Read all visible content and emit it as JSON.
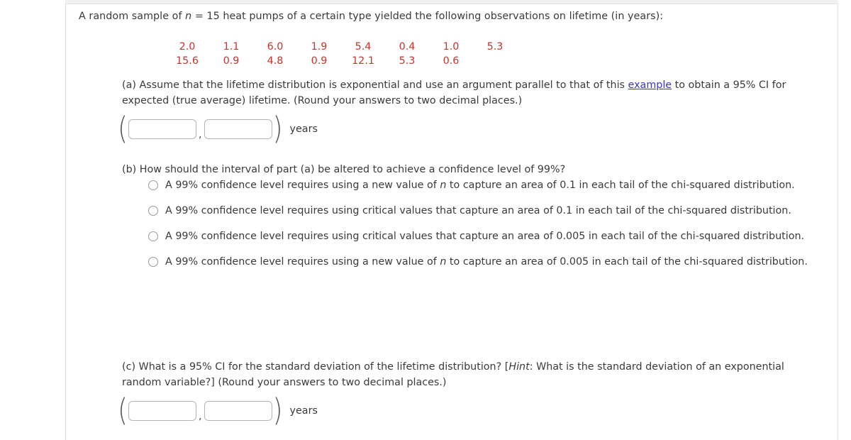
{
  "question": {
    "intro_pre": "A random sample of ",
    "intro_var": "n",
    "intro_post": " = 15 heat pumps of a certain type yielded the following observations on lifetime (in years):",
    "observations_row1": [
      "2.0",
      "1.1",
      "6.0",
      "1.9",
      "5.4",
      "0.4",
      "1.0",
      "5.3"
    ],
    "observations_row2": [
      "15.6",
      "0.9",
      "4.8",
      "0.9",
      "12.1",
      "5.3",
      "0.6"
    ]
  },
  "part_a": {
    "text_1": "(a) Assume that the lifetime distribution is exponential and use an argument parallel to that of this ",
    "link_text": "example",
    "text_2": " to obtain a 95% CI for expected (true average) lifetime. (Round your answers to two decimal places.)",
    "open_paren": "(",
    "close_paren": ")",
    "comma": ",",
    "lower_value": "",
    "upper_value": "",
    "units": "years"
  },
  "part_b": {
    "prompt": "(b) How should the interval of part (a) be altered to achieve a confidence level of 99%?",
    "options": [
      {
        "pre": "A 99% confidence level requires using a new value of ",
        "var": "n",
        "post": " to capture an area of 0.1 in each tail of the chi-squared distribution."
      },
      {
        "pre": "A 99% confidence level requires using critical values that capture an area of 0.1 in each tail of the chi-squared distribution.",
        "var": "",
        "post": ""
      },
      {
        "pre": "A 99% confidence level requires using critical values that capture an area of 0.005 in each tail of the chi-squared distribution.",
        "var": "",
        "post": ""
      },
      {
        "pre": "A 99% confidence level requires using a new value of ",
        "var": "n",
        "post": " to capture an area of 0.005 in each tail of the chi-squared distribution."
      }
    ]
  },
  "part_c": {
    "text_1": "(c) What is a 95% CI for the standard deviation of the lifetime distribution? [",
    "hint_word": "Hint",
    "text_2": ": What is the standard deviation of an exponential random variable?] (Round your answers to two decimal places.)",
    "open_paren": "(",
    "close_paren": ")",
    "comma": ",",
    "lower_value": "",
    "upper_value": "",
    "units": "years"
  },
  "colors": {
    "data_red": "#c2362c",
    "link_blue": "#3b36c8",
    "body_text": "#3a3a3a"
  }
}
